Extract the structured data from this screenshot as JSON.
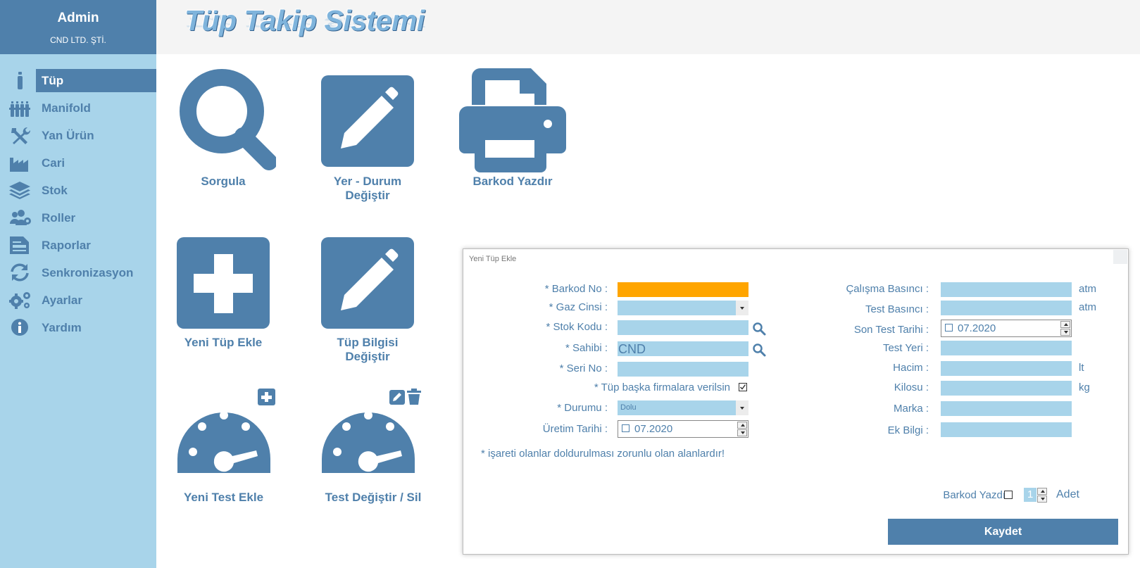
{
  "user": {
    "name": "Admin",
    "company": "CND LTD. ŞTİ."
  },
  "app": {
    "title": "Tüp Takip Sistemi"
  },
  "colors": {
    "primary": "#4f80ab",
    "sidebar_bg": "#a8d4ea",
    "required_field": "#ffa500"
  },
  "sidebar": {
    "items": [
      {
        "label": "Tüp",
        "icon": "tube-icon",
        "active": true
      },
      {
        "label": "Manifold",
        "icon": "manifold-icon"
      },
      {
        "label": "Yan Ürün",
        "icon": "tools-icon"
      },
      {
        "label": "Cari",
        "icon": "factory-icon"
      },
      {
        "label": "Stok",
        "icon": "layers-icon"
      },
      {
        "label": "Roller",
        "icon": "users-icon"
      },
      {
        "label": "Raporlar",
        "icon": "report-icon"
      },
      {
        "label": "Senkronizasyon",
        "icon": "sync-icon"
      },
      {
        "label": "Ayarlar",
        "icon": "gears-icon"
      },
      {
        "label": "Yardım",
        "icon": "info-icon"
      }
    ]
  },
  "tiles": {
    "sorgula": "Sorgula",
    "yer_durum_1": "Yer - Durum",
    "yer_durum_2": "Değiştir",
    "barkod_yazdir": "Barkod Yazdır",
    "yeni_tup": "Yeni Tüp Ekle",
    "tup_bilgisi_1": "Tüp Bilgisi",
    "tup_bilgisi_2": "Değiştir",
    "yeni_test": "Yeni Test Ekle",
    "test_degistir": "Test Değiştir / Sil"
  },
  "dialog": {
    "title": "Yeni Tüp Ekle",
    "left": {
      "barkod_no": "* Barkod No :",
      "gaz_cinsi": "* Gaz Cinsi :",
      "stok_kodu": "* Stok Kodu :",
      "sahibi": "* Sahibi :",
      "sahibi_value": "CND",
      "seri_no": "* Seri No :",
      "baska_firma": "* Tüp başka firmalara verilsin",
      "baska_firma_checked": true,
      "durumu": "* Durumu :",
      "durumu_value": "Dolu",
      "uretim_tarihi": "Üretim Tarihi :",
      "uretim_tarihi_value": "07.2020"
    },
    "right": {
      "calisma_basinci": "Çalışma Basıncı :",
      "calisma_unit": "atm",
      "test_basinci": "Test Basıncı :",
      "test_unit": "atm",
      "son_test_tarihi": "Son Test Tarihi :",
      "son_test_value": "07.2020",
      "test_yeri": "Test Yeri :",
      "hacim": "Hacim :",
      "hacim_unit": "lt",
      "kilosu": "Kilosu :",
      "kilosu_unit": "kg",
      "marka": "Marka :",
      "ek_bilgi": "Ek Bilgi :"
    },
    "note": "* işareti olanlar doldurulması zorunlu olan alanlardır!",
    "barkod_yazdir": "Barkod Yazdır",
    "barkod_yazdir_checked": false,
    "adet_value": "1",
    "adet": "Adet",
    "save": "Kaydet"
  }
}
